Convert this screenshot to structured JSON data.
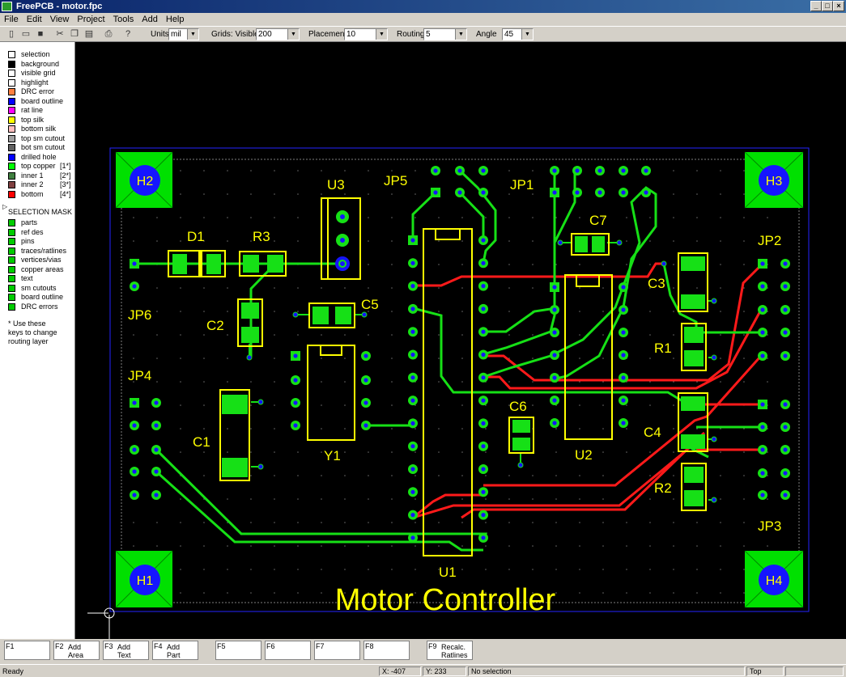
{
  "window": {
    "title": "FreePCB - motor.fpc"
  },
  "menu": [
    "File",
    "Edit",
    "View",
    "Project",
    "Tools",
    "Add",
    "Help"
  ],
  "toolbar": {
    "units_label": "Units",
    "units_value": "mil",
    "grids_label": "Grids: Visible",
    "grids_value": "200",
    "placement_label": "Placement",
    "placement_value": "10",
    "routing_label": "Routing",
    "routing_value": "5",
    "angle_label": "Angle",
    "angle_value": "45"
  },
  "layers": [
    {
      "name": "selection",
      "color": "#ffffff",
      "hotkey": ""
    },
    {
      "name": "background",
      "color": "#000000",
      "hotkey": ""
    },
    {
      "name": "visible grid",
      "color": "#ffffff",
      "hotkey": ""
    },
    {
      "name": "highlight",
      "color": "#ffffff",
      "hotkey": ""
    },
    {
      "name": "DRC error",
      "color": "#ff8040",
      "hotkey": ""
    },
    {
      "name": "board outline",
      "color": "#0000ff",
      "hotkey": ""
    },
    {
      "name": "rat line",
      "color": "#ff00ff",
      "hotkey": ""
    },
    {
      "name": "top silk",
      "color": "#ffff00",
      "hotkey": ""
    },
    {
      "name": "bottom silk",
      "color": "#ffc0c0",
      "hotkey": ""
    },
    {
      "name": "top sm cutout",
      "color": "#a0a0a0",
      "hotkey": ""
    },
    {
      "name": "bot sm cutout",
      "color": "#606060",
      "hotkey": ""
    },
    {
      "name": "drilled hole",
      "color": "#0000ff",
      "hotkey": ""
    },
    {
      "name": "top copper",
      "color": "#00ff00",
      "hotkey": "[1*]"
    },
    {
      "name": "inner 1",
      "color": "#408040",
      "hotkey": "[2*]"
    },
    {
      "name": "inner 2",
      "color": "#804040",
      "hotkey": "[3*]"
    },
    {
      "name": "bottom",
      "color": "#ff0000",
      "hotkey": "[4*]"
    }
  ],
  "selection_mask": {
    "heading": "SELECTION MASK",
    "items": [
      "parts",
      "ref des",
      "pins",
      "traces/ratlines",
      "vertices/vias",
      "copper areas",
      "text",
      "sm cutouts",
      "board outline",
      "DRC errors"
    ],
    "color": "#00cc00"
  },
  "note": [
    "* Use these",
    "keys to change",
    "routing layer"
  ],
  "pcb": {
    "board_text": "Motor Controller",
    "refs": {
      "H1": "H1",
      "H2": "H2",
      "H3": "H3",
      "H4": "H4",
      "D1": "D1",
      "R3": "R3",
      "U3": "U3",
      "JP5": "JP5",
      "JP1": "JP1",
      "C7": "C7",
      "JP2": "JP2",
      "C3": "C3",
      "R1": "R1",
      "C4": "C4",
      "R2": "R2",
      "JP3": "JP3",
      "JP6": "JP6",
      "C2": "C2",
      "C5": "C5",
      "JP4": "JP4",
      "C1": "C1",
      "Y1": "Y1",
      "C6": "C6",
      "U2": "U2",
      "U1": "U1"
    }
  },
  "fkeys": [
    {
      "key": "F1",
      "line1": "",
      "line2": ""
    },
    {
      "key": "F2",
      "line1": "Add",
      "line2": "Area"
    },
    {
      "key": "F3",
      "line1": "Add",
      "line2": "Text"
    },
    {
      "key": "F4",
      "line1": "Add",
      "line2": "Part"
    },
    {
      "key": "F5",
      "line1": "",
      "line2": ""
    },
    {
      "key": "F6",
      "line1": "",
      "line2": ""
    },
    {
      "key": "F7",
      "line1": "",
      "line2": ""
    },
    {
      "key": "F8",
      "line1": "",
      "line2": ""
    },
    {
      "key": "F9",
      "line1": "Recalc.",
      "line2": "Ratlines"
    }
  ],
  "status": {
    "ready": "Ready",
    "x": "X: -407",
    "y": "Y: 233",
    "selection": "No selection",
    "layer": "Top"
  }
}
